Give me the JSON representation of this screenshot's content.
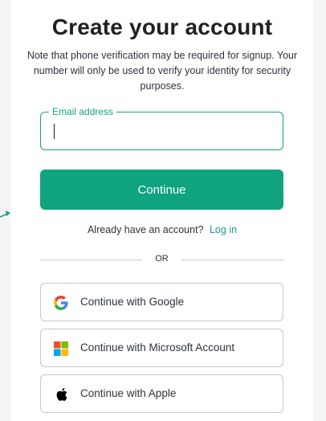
{
  "header": {
    "title": "Create your account",
    "subtitle": "Note that phone verification may be required for signup. Your number will only be used to verify your identity for security purposes."
  },
  "email": {
    "label": "Email address",
    "value": ""
  },
  "continue_button": {
    "label": "Continue"
  },
  "login": {
    "prompt": "Already have an account?",
    "link_label": "Log in"
  },
  "divider": {
    "label": "OR"
  },
  "social": [
    {
      "label": "Continue with Google",
      "icon": "google-icon"
    },
    {
      "label": "Continue with Microsoft Account",
      "icon": "microsoft-icon"
    },
    {
      "label": "Continue with Apple",
      "icon": "apple-icon"
    }
  ],
  "colors": {
    "accent": "#10a37f",
    "text": "#2d333a",
    "border": "#c2c8d0",
    "background": "#f5f5f5"
  }
}
